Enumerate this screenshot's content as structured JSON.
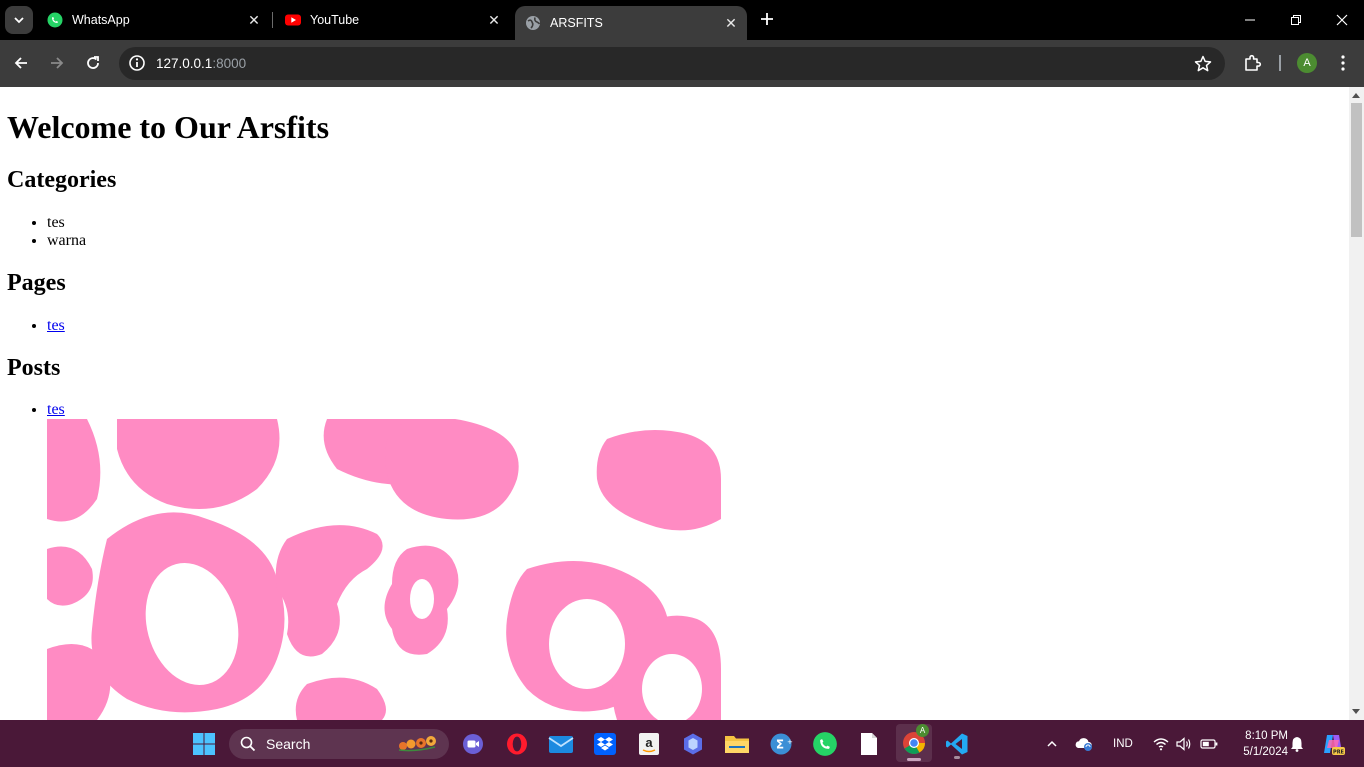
{
  "browser": {
    "tabs": [
      {
        "title": "WhatsApp",
        "icon": "whatsapp-icon",
        "active": false
      },
      {
        "title": "YouTube",
        "icon": "youtube-icon",
        "active": false
      },
      {
        "title": "ARSFITS",
        "icon": "globe-icon",
        "active": true
      }
    ],
    "address": {
      "host": "127.0.0.1",
      "port": ":8000"
    },
    "profile_initial": "A"
  },
  "page": {
    "title": "Welcome to Our Arsfits",
    "categories_heading": "Categories",
    "categories": [
      "tes",
      "warna"
    ],
    "pages_heading": "Pages",
    "pages": [
      "tes"
    ],
    "posts_heading": "Posts",
    "posts": [
      "tes"
    ],
    "post_image_colors": {
      "background": "#ffffff",
      "blob": "#ff8bc3"
    }
  },
  "taskbar": {
    "search_placeholder": "Search",
    "language": "IND",
    "time": "8:10 PM",
    "date": "5/1/2024",
    "accent": "#4a1838"
  }
}
